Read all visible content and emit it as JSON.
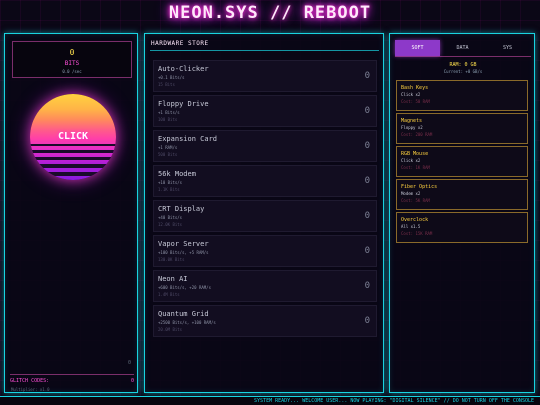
{
  "title": "NEON.SYS // REBOOT",
  "counter": {
    "value": "0",
    "label": "BITS",
    "rate": "0.0 /sec"
  },
  "clicker": {
    "label": "CLICK"
  },
  "glitch": {
    "label": "GLITCH CODES:",
    "count": "0"
  },
  "version": "Multiplier: x1.0",
  "left_marker": "0",
  "store": {
    "heading": "HARDWARE STORE",
    "items": [
      {
        "name": "Auto-Clicker",
        "effect": "+0.1 Bits/s",
        "cost": "15 Bits",
        "owned": "0"
      },
      {
        "name": "Floppy Drive",
        "effect": "+1 Bits/s",
        "cost": "100 Bits",
        "owned": "0"
      },
      {
        "name": "Expansion Card",
        "effect": "+1 RAM/s",
        "cost": "500 Bits",
        "owned": "0"
      },
      {
        "name": "56k Modem",
        "effect": "+10 Bits/s",
        "cost": "1.1K Bits",
        "owned": "0"
      },
      {
        "name": "CRT Display",
        "effect": "+40 Bits/s",
        "cost": "12.0K Bits",
        "owned": "0"
      },
      {
        "name": "Vapor Server",
        "effect": "+100 Bits/s, +5 RAM/s",
        "cost": "130.0K Bits",
        "owned": "0"
      },
      {
        "name": "Neon AI",
        "effect": "+600 Bits/s, +20 RAM/s",
        "cost": "1.4M Bits",
        "owned": "0"
      },
      {
        "name": "Quantum Grid",
        "effect": "+2500 Bits/s, +100 RAM/s",
        "cost": "20.0M Bits",
        "owned": "0"
      }
    ]
  },
  "tabs": [
    "SOFT",
    "DATA",
    "SYS"
  ],
  "ram": {
    "value": "RAM: 0 GB",
    "rate": "Current: +0 GB/s"
  },
  "upgrades": [
    {
      "name": "Bash Keys",
      "desc": "Click x2",
      "cost": "Cost: 50 RAM"
    },
    {
      "name": "Magnets",
      "desc": "Floppy x2",
      "cost": "Cost: 200 RAM"
    },
    {
      "name": "RGB Mouse",
      "desc": "Click x2",
      "cost": "Cost: 1K RAM"
    },
    {
      "name": "Fiber Optics",
      "desc": "Modem x2",
      "cost": "Cost: 5K RAM"
    },
    {
      "name": "Overclock",
      "desc": "All x1.5",
      "cost": "Cost: 15K RAM"
    }
  ],
  "ticker": "SYSTEM READY... WELCOME USER... NOW PLAYING: \"DIGITAL SILENCE\" // DO NOT TURN OFF THE CONSOLE",
  "colors": {
    "accent": "#19d3e0",
    "pink": "#ff2bd6",
    "gold": "#ffd23f",
    "tab_active": "#8d39c9"
  }
}
